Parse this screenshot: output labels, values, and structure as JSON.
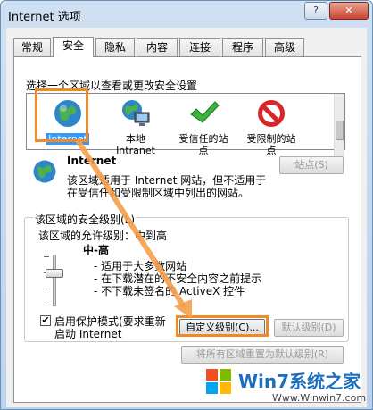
{
  "window": {
    "title": "Internet 选项",
    "help_label": "?",
    "close_label": "✕"
  },
  "tabs": [
    {
      "label": "常规"
    },
    {
      "label": "安全"
    },
    {
      "label": "隐私"
    },
    {
      "label": "内容"
    },
    {
      "label": "连接"
    },
    {
      "label": "程序"
    },
    {
      "label": "高级"
    }
  ],
  "security": {
    "select_zone_label": "选择一个区域以查看或更改安全设置",
    "zones": [
      {
        "label": "Internet",
        "icon": "globe-icon"
      },
      {
        "label": "本地\nIntranet",
        "icon": "intranet-icon"
      },
      {
        "label": "受信任的站\n点",
        "icon": "checkmark-icon"
      },
      {
        "label": "受限制的站\n点",
        "icon": "restricted-icon"
      }
    ],
    "zone_title": "Internet",
    "zone_desc_line1": "该区域适用于 Internet 网站，但不适用于",
    "zone_desc_line2": "在受信任和受限制区域中列出的网站。",
    "sites_button": "站点(S)",
    "level_group_label": "该区域的安全级别(L)",
    "allowed_levels_label": "该区域的允许级别：中到高",
    "level_name": "中-高",
    "level_points": [
      "- 适用于大多数网站",
      "- 在下载潜在的不安全内容之前提示",
      "- 不下载未签名的 ActiveX 控件"
    ],
    "protected_mode_label_line1": "启用保护模式(要求重新",
    "protected_mode_label_line2": "启动 Internet",
    "protected_mode_checked": true,
    "custom_level_button": "自定义级别(C)...",
    "default_level_button": "默认级别(D)",
    "reset_all_button": "将所有区域重置为默认级别(R)"
  },
  "watermark": {
    "brand": "Win7系统之家",
    "url": "Www.Winwin7.com"
  },
  "colors": {
    "highlight": "#f08a24",
    "selection": "#3399ff",
    "arrow": "#f5a04a"
  }
}
